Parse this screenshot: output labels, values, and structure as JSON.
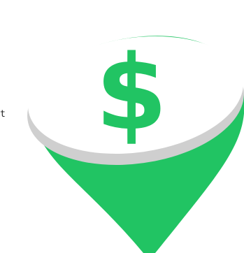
{
  "fragment_text": "t",
  "icon": {
    "name": "map-pin-dollar-icon",
    "symbol": "$"
  },
  "colors": {
    "pin_green": "#21c463",
    "cap_white": "#ffffff",
    "cap_shadow": "#cfcfcf",
    "ink": "#222222"
  }
}
